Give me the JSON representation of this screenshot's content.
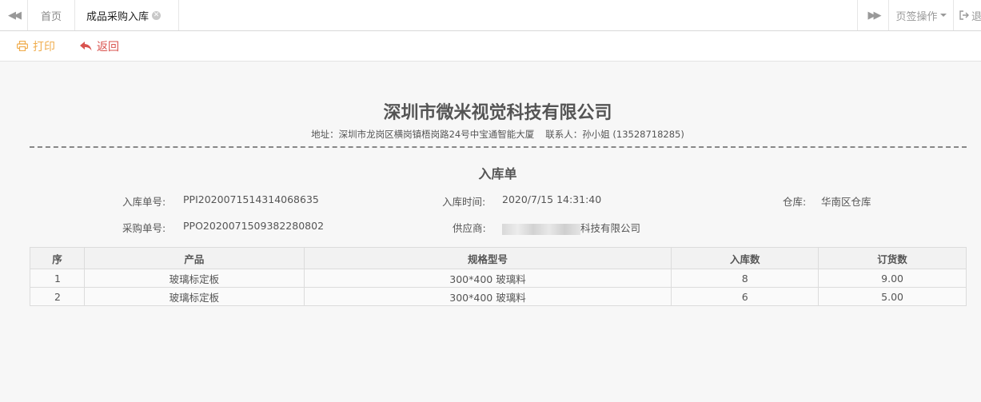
{
  "tabs": {
    "home": "首页",
    "active": "成品采购入库",
    "page_ops": "页签操作",
    "exit": "退"
  },
  "toolbar": {
    "print": "打印",
    "back": "返回"
  },
  "doc": {
    "company": "深圳市微米视觉科技有限公司",
    "address": "地址：深圳市龙岗区横岗镇梧岗路24号中宝通智能大厦",
    "contact": "联系人：孙小姐 (13528718285)",
    "title": "入库单",
    "fields": {
      "inbound_no_label": "入库单号:",
      "inbound_no": "PPI2020071514314068635",
      "inbound_time_label": "入库时间:",
      "inbound_time": "2020/7/15 14:31:40",
      "warehouse_label": "仓库:",
      "warehouse": "华南区仓库",
      "purchase_no_label": "采购单号:",
      "purchase_no": "PPO2020071509382280802",
      "supplier_label": "供应商:",
      "supplier_visible": "科技有限公司"
    }
  },
  "table": {
    "headers": [
      "序",
      "产品",
      "规格型号",
      "入库数",
      "订货数"
    ],
    "rows": [
      [
        "1",
        "玻璃标定板",
        "300*400 玻璃料",
        "8",
        "9.00"
      ],
      [
        "2",
        "玻璃标定板",
        "300*400 玻璃料",
        "6",
        "5.00"
      ]
    ]
  }
}
